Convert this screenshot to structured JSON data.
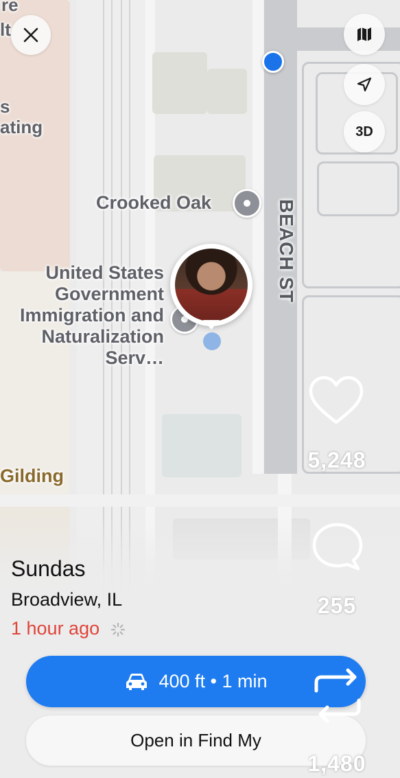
{
  "map": {
    "edge_labels": [
      "re",
      "lt",
      "s",
      "ating"
    ],
    "poi_crooked_oak": "Crooked Oak",
    "poi_uscis_lines": [
      "United States",
      "Government",
      "Immigration and",
      "Naturalization",
      "Serv…"
    ],
    "place_gilding": "Gilding",
    "street_name": "BEACH ST",
    "controls": {
      "map_icon": "map-icon",
      "location_icon": "location-arrow-icon",
      "view_3d": "3D"
    },
    "close_icon": "close-icon"
  },
  "person": {
    "name": "Sundas",
    "location": "Broadview, IL",
    "last_seen": "1 hour ago"
  },
  "actions": {
    "directions": "400 ft • 1 min",
    "directions_icon": "car-icon",
    "open_find_my": "Open in Find My"
  },
  "social": {
    "likes": "5,248",
    "comments": "255",
    "reposts": "1,480"
  },
  "colors": {
    "accent_blue": "#1f7cf0",
    "time_red": "#e0443a",
    "user_dot": "#1a73e8"
  }
}
